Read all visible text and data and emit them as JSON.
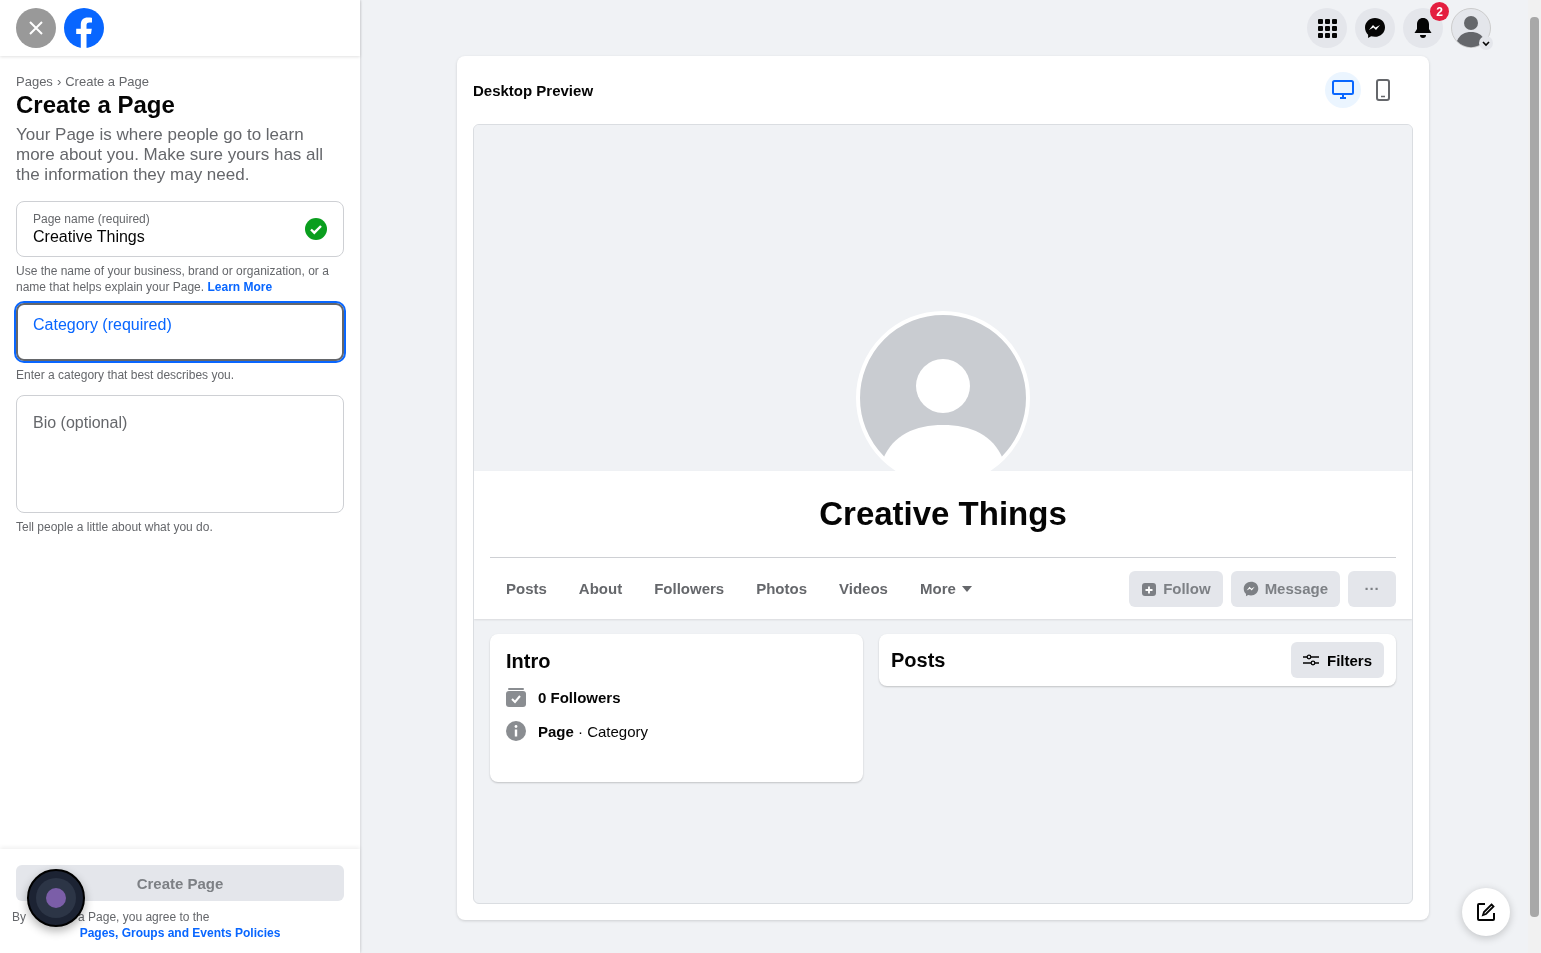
{
  "top_nav": {
    "notification_count": "2"
  },
  "sidebar": {
    "breadcrumb": {
      "parent": "Pages",
      "separator": "›",
      "current": "Create a Page"
    },
    "title": "Create a Page",
    "description": "Your Page is where people go to learn more about you. Make sure yours has all the information they may need.",
    "fields": [
      {
        "kind": "text",
        "label": "Page name (required)",
        "value": "Creative Things",
        "valid": true,
        "focused": false,
        "help": "Use the name of your business, brand or organization, or a name that helps explain your Page.",
        "help_link": "Learn More"
      },
      {
        "kind": "text",
        "placeholder": "Category (required)",
        "valid": false,
        "focused": true,
        "help": "Enter a category that best describes you."
      },
      {
        "kind": "textarea",
        "placeholder": "Bio (optional)",
        "focused": false,
        "help": "Tell people a little about what you do."
      }
    ],
    "create_button": {
      "label": "Create Page",
      "disabled": true
    },
    "terms": {
      "lead": "By",
      "text": "a Page, you agree to the",
      "link": "Pages, Groups and Events Policies"
    }
  },
  "preview": {
    "title": "Desktop Preview",
    "modes": [
      {
        "kind": "desktop",
        "selected": true
      },
      {
        "kind": "mobile",
        "selected": false
      }
    ],
    "page_name": "Creative Things",
    "tabs": [
      {
        "label": "Posts",
        "kind": "tab"
      },
      {
        "label": "About",
        "kind": "tab"
      },
      {
        "label": "Followers",
        "kind": "tab"
      },
      {
        "label": "Photos",
        "kind": "tab"
      },
      {
        "label": "Videos",
        "kind": "tab"
      },
      {
        "label": "More",
        "kind": "dropdown"
      }
    ],
    "actions": [
      {
        "kind": "follow",
        "label": "Follow",
        "disabled": true
      },
      {
        "kind": "message",
        "label": "Message",
        "disabled": true
      },
      {
        "kind": "more",
        "label": "···",
        "disabled": true
      }
    ],
    "intro": {
      "title": "Intro",
      "items": [
        {
          "kind": "followers",
          "text": "**0 Followers**"
        },
        {
          "kind": "info",
          "text": "**Page** · Category"
        }
      ]
    },
    "posts": {
      "title": "Posts",
      "filter": "Filters"
    }
  }
}
